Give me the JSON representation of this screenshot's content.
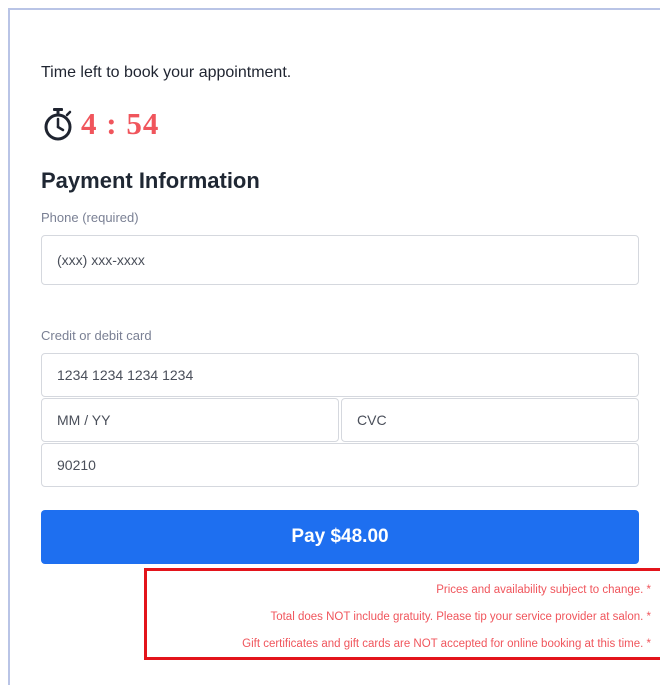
{
  "booking": {
    "timer_note": "Time left to book your appointment.",
    "timer_value": "4 : 54",
    "timer_icon": "stopwatch-icon"
  },
  "payment": {
    "title": "Payment Information",
    "phone_label": "Phone (required)",
    "phone_placeholder": "(xxx) xxx-xxxx",
    "phone_value": "",
    "card_label": "Credit or debit card",
    "card_number_placeholder": "1234 1234 1234 1234",
    "card_expiry_placeholder": "MM / YY",
    "card_cvc_placeholder": "CVC",
    "card_zip_placeholder": "90210",
    "pay_label": "Pay $48.00"
  },
  "disclaimers": [
    "Prices and availability subject to change. *",
    "Total does NOT include gratuity. Please tip your service provider at salon. *",
    "Gift certificates and gift cards are NOT accepted for online booking at this time. *"
  ],
  "colors": {
    "accent": "#1e6ff0",
    "timer": "#f0555c",
    "highlight_border": "#e3141b",
    "frame_border": "#b9c4e6"
  }
}
